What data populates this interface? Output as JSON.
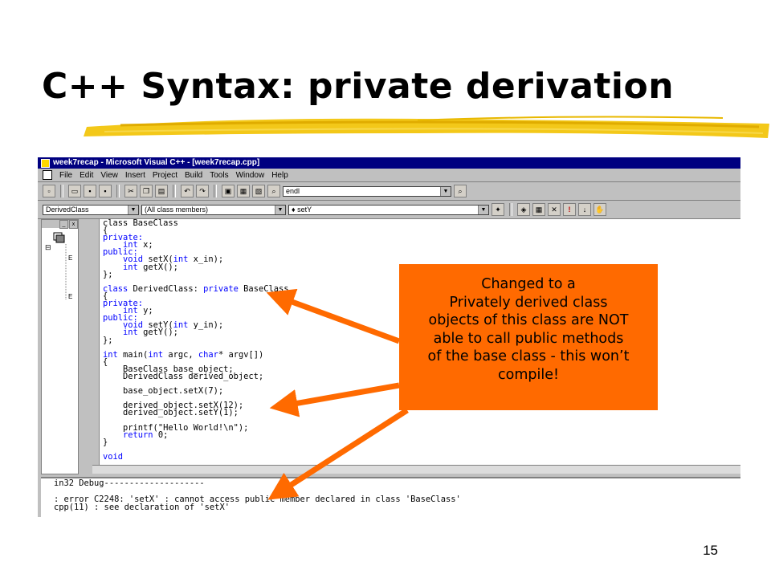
{
  "slide": {
    "title": "C++ Syntax: private derivation",
    "page_number": "15"
  },
  "ide": {
    "window_title": "week7recap - Microsoft Visual C++ - [week7recap.cpp]",
    "menu": [
      "File",
      "Edit",
      "View",
      "Insert",
      "Project",
      "Build",
      "Tools",
      "Window",
      "Help"
    ],
    "find_combo": "endl",
    "class_combo": "DerivedClass",
    "members_combo": "(All class members)",
    "function_combo": "setY",
    "code": [
      [
        {
          "t": "class BaseClass"
        }
      ],
      [
        {
          "t": "{"
        }
      ],
      [
        {
          "t": "private:",
          "k": true
        }
      ],
      [
        {
          "t": "    "
        },
        {
          "t": "int",
          "k": true
        },
        {
          "t": " x;"
        }
      ],
      [
        {
          "t": "public:",
          "k": true
        }
      ],
      [
        {
          "t": "    "
        },
        {
          "t": "void",
          "k": true
        },
        {
          "t": " setX("
        },
        {
          "t": "int",
          "k": true
        },
        {
          "t": " x_in);"
        }
      ],
      [
        {
          "t": "    "
        },
        {
          "t": "int",
          "k": true
        },
        {
          "t": " getX();"
        }
      ],
      [
        {
          "t": "};"
        }
      ],
      [
        {
          "t": ""
        }
      ],
      [
        {
          "t": "class",
          "k": true
        },
        {
          "t": " DerivedClass: "
        },
        {
          "t": "private",
          "k": true
        },
        {
          "t": " BaseClass"
        }
      ],
      [
        {
          "t": "{"
        }
      ],
      [
        {
          "t": "private:",
          "k": true
        }
      ],
      [
        {
          "t": "    "
        },
        {
          "t": "int",
          "k": true
        },
        {
          "t": " y;"
        }
      ],
      [
        {
          "t": "public:",
          "k": true
        }
      ],
      [
        {
          "t": "    "
        },
        {
          "t": "void",
          "k": true
        },
        {
          "t": " setY("
        },
        {
          "t": "int",
          "k": true
        },
        {
          "t": " y_in);"
        }
      ],
      [
        {
          "t": "    "
        },
        {
          "t": "int",
          "k": true
        },
        {
          "t": " getY();"
        }
      ],
      [
        {
          "t": "};"
        }
      ],
      [
        {
          "t": ""
        }
      ],
      [
        {
          "t": "int",
          "k": true
        },
        {
          "t": " main("
        },
        {
          "t": "int",
          "k": true
        },
        {
          "t": " argc, "
        },
        {
          "t": "char",
          "k": true
        },
        {
          "t": "* argv[])"
        }
      ],
      [
        {
          "t": "{"
        }
      ],
      [
        {
          "t": "    BaseClass base_object;"
        }
      ],
      [
        {
          "t": "    DerivedClass derived_object;"
        }
      ],
      [
        {
          "t": ""
        }
      ],
      [
        {
          "t": "    base_object.setX(7);"
        }
      ],
      [
        {
          "t": ""
        }
      ],
      [
        {
          "t": "    derived_object.setX(12);"
        }
      ],
      [
        {
          "t": "    derived_object.setY(1);"
        }
      ],
      [
        {
          "t": ""
        }
      ],
      [
        {
          "t": "    printf(\"Hello World!\\n\");"
        }
      ],
      [
        {
          "t": "    "
        },
        {
          "t": "return",
          "k": true
        },
        {
          "t": " 0;"
        }
      ],
      [
        {
          "t": "}"
        }
      ],
      [
        {
          "t": ""
        }
      ],
      [
        {
          "t": "void",
          "k": true
        }
      ]
    ],
    "output": [
      "in32 Debug--------------------",
      "",
      ": error C2248: 'setX' : cannot access public member declared in class 'BaseClass'",
      "cpp(11) : see declaration of 'setX'"
    ]
  },
  "callout": {
    "lines": [
      "Changed to a",
      "Privately derived class",
      "objects of this class are NOT",
      "able to call public methods",
      "of the base class - this won’t",
      "compile!"
    ]
  },
  "colors": {
    "callout": "#ff6a00",
    "titlebar": "#000080",
    "keyword": "#0000ff",
    "brush": "#f2c200"
  }
}
